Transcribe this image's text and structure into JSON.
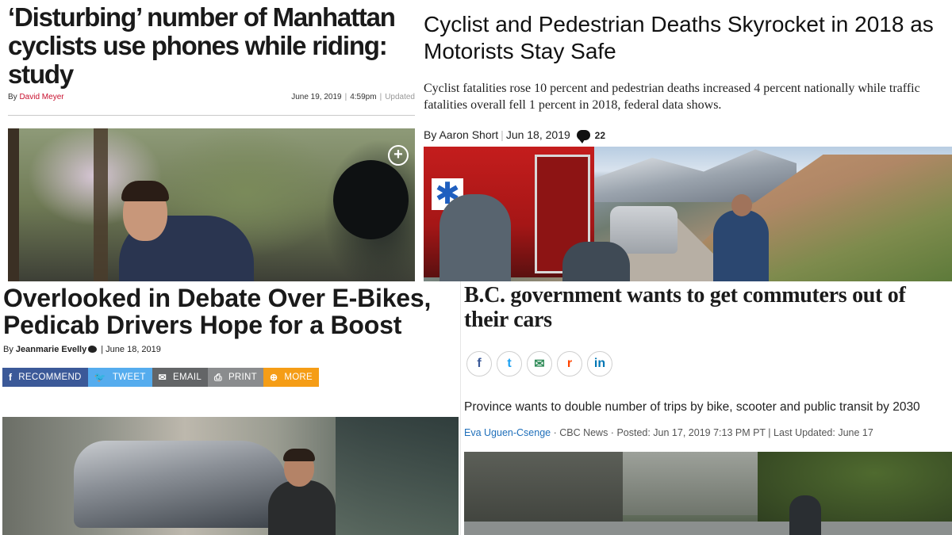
{
  "panel1": {
    "headline": "‘Disturbing’ number of Manhattan cyclists use phones while riding: study",
    "byline_prefix": "By",
    "author": "David Meyer",
    "date": "June 19, 2019",
    "time": "4:59pm",
    "separator": "|",
    "updated_label": "Updated",
    "photo_icon": "plus-circle-icon"
  },
  "panel2": {
    "headline": "Cyclist and Pedestrian Deaths Skyrocket in 2018 as Motorists Stay Safe",
    "dek": "Cyclist fatalities rose 10 percent and pedestrian deaths increased 4 percent nationally while traffic fatalities overall fell 1 percent in 2018, federal data shows.",
    "byline": "By Aaron Short",
    "separator": "|",
    "date": "Jun 18, 2019",
    "comment_count": "22",
    "comment_icon": "speech-bubble-icon"
  },
  "panel3": {
    "headline": "Overlooked in Debate Over E-Bikes, Pedicab Drivers Hope for a Boost",
    "byline_prefix": "By",
    "author": "Jeanmarie Evelly",
    "date": "| June 18, 2019",
    "share": [
      {
        "label": "RECOMMEND",
        "icon": "f",
        "color": "#3b5998"
      },
      {
        "label": "TWEET",
        "icon": "🐦",
        "color": "#55acee"
      },
      {
        "label": "EMAIL",
        "icon": "✉",
        "color": "#636567"
      },
      {
        "label": "PRINT",
        "icon": "⎙",
        "color": "#8a8c8e"
      },
      {
        "label": "MORE",
        "icon": "⊕",
        "color": "#f59d16"
      }
    ]
  },
  "panel4": {
    "headline": "B.C. government wants to get commuters out of their cars",
    "social": [
      {
        "glyph": "f",
        "color": "#3b5998",
        "icon": "facebook-icon"
      },
      {
        "glyph": "t",
        "color": "#1da1f2",
        "icon": "twitter-icon"
      },
      {
        "glyph": "✉",
        "color": "#2e8b57",
        "icon": "email-icon"
      },
      {
        "glyph": "r",
        "color": "#ff4500",
        "icon": "reddit-icon"
      },
      {
        "glyph": "in",
        "color": "#0077b5",
        "icon": "linkedin-icon"
      }
    ],
    "dek": "Province wants to double number of trips by bike, scooter and public transit by 2030",
    "author": "Eva Uguen-Csenge",
    "byline_rest": " · CBC News · Posted: Jun 17, 2019 7:13 PM PT | Last Updated: June 17"
  }
}
